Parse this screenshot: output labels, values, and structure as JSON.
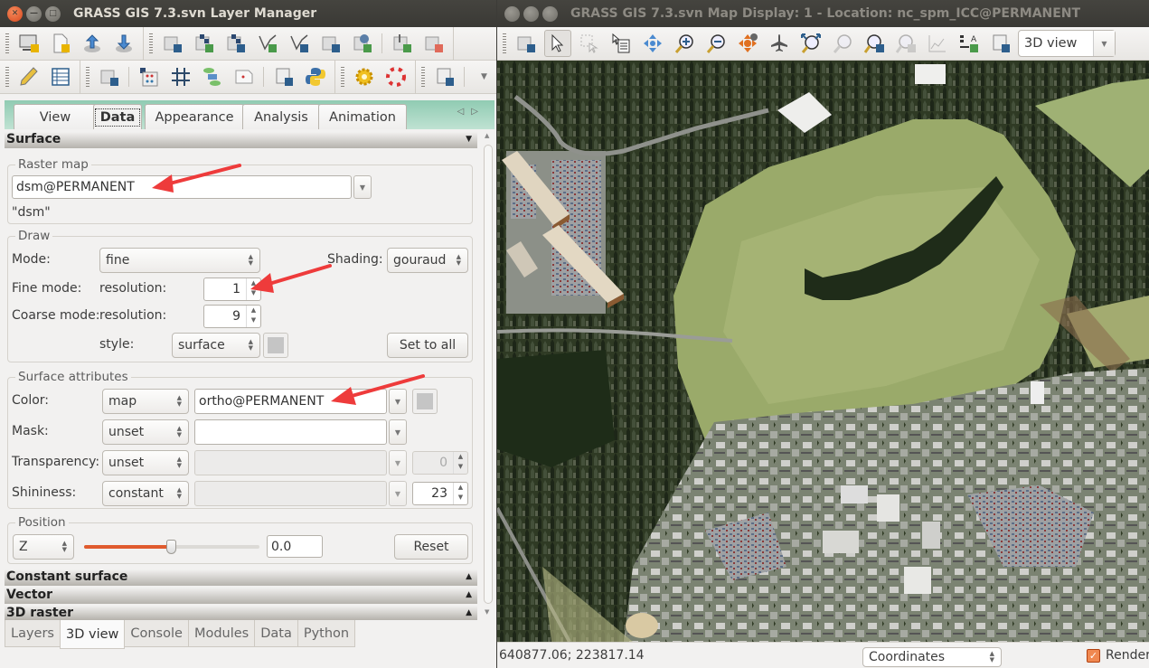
{
  "layer_manager": {
    "title": "GRASS GIS 7.3.svn Layer Manager",
    "toolbar1": [
      "new-display-icon",
      "new-workspace-icon",
      "open-workspace-icon",
      "save-workspace-icon",
      "import-layers-icon",
      "add-raster-icon",
      "add-raster-misc-icon",
      "add-vector-icon",
      "add-vector-misc-icon",
      "add-group-icon",
      "add-overlay-icon",
      "add-command-icon",
      "remove-layer-icon"
    ],
    "toolbar2": [
      "vector-digitizer-icon",
      "attribute-table-icon",
      "georectifier-icon",
      "raster-calculator-icon",
      "grid-icon",
      "graphical-modeler-icon",
      "cartographic-composer-icon",
      "script-run-icon",
      "python-icon",
      "settings-icon",
      "help-icon",
      "launch-script-icon",
      "toolbar-overflow-icon"
    ],
    "notebook_tabs": [
      {
        "label": "View",
        "selected": false
      },
      {
        "label": "Data",
        "selected": true
      },
      {
        "label": "Appearance",
        "selected": false
      },
      {
        "label": "Analysis",
        "selected": false
      },
      {
        "label": "Animation",
        "selected": false
      }
    ],
    "surface": {
      "header": "Surface",
      "raster_map": {
        "legend": "Raster map",
        "value": "dsm@PERMANENT",
        "description": "\"dsm\""
      },
      "draw": {
        "legend": "Draw",
        "mode_label": "Mode:",
        "mode_value": "fine",
        "shading_label": "Shading:",
        "shading_value": "gouraud",
        "fine_mode_label": "Fine mode:",
        "fine_resolution_label": "resolution:",
        "fine_resolution_value": "1",
        "coarse_mode_label": "Coarse mode:",
        "coarse_resolution_label": "resolution:",
        "coarse_resolution_value": "9",
        "style_label": "style:",
        "style_value": "surface",
        "wire_color": "#c5c5c5",
        "set_to_all_label": "Set to all"
      },
      "attributes": {
        "legend": "Surface attributes",
        "rows": [
          {
            "label": "Color:",
            "type": "map",
            "map": "ortho@PERMANENT",
            "enabled": true
          },
          {
            "label": "Mask:",
            "type": "unset",
            "map": "",
            "enabled": true
          },
          {
            "label": "Transparency:",
            "type": "unset",
            "map": "",
            "value": "0",
            "enabled": false
          },
          {
            "label": "Shininess:",
            "type": "constant",
            "map": "",
            "value": "23",
            "enabled": false
          }
        ],
        "color_swatch": "#c5c5c5"
      },
      "position": {
        "legend": "Position",
        "axis": "Z",
        "slider_fraction": 0.5,
        "value": "0.0",
        "reset_label": "Reset"
      }
    },
    "folds": [
      {
        "label": "Constant surface"
      },
      {
        "label": "Vector"
      },
      {
        "label": "3D raster"
      }
    ],
    "bottom_tabs": [
      {
        "label": "Layers",
        "selected": false
      },
      {
        "label": "3D view",
        "selected": true
      },
      {
        "label": "Console",
        "selected": false
      },
      {
        "label": "Modules",
        "selected": false
      },
      {
        "label": "Data",
        "selected": false
      },
      {
        "label": "Python",
        "selected": false
      }
    ],
    "annotation_color": "#ee3b3b"
  },
  "map_display": {
    "title": "GRASS GIS 7.3.svn Map Display: 1 - Location: nc_spm_ICC@PERMANENT",
    "toolbar": [
      "new-display-icon",
      "pointer-icon",
      "select-icon",
      "query-icon",
      "pan-icon",
      "zoom-in-icon",
      "zoom-out-icon",
      "zoom-back-icon",
      "fly-through-icon",
      "zoom-extent-icon",
      "zoom-region-icon",
      "zoom-back-arrow-icon",
      "zoom-saved-icon",
      "analyze-icon",
      "overlay-icon",
      "save-image-icon"
    ],
    "view_mode": "3D view",
    "coordinates": "640877.06; 223817.14",
    "status_mode": "Coordinates",
    "render_label": "Render",
    "render_checked": true
  }
}
